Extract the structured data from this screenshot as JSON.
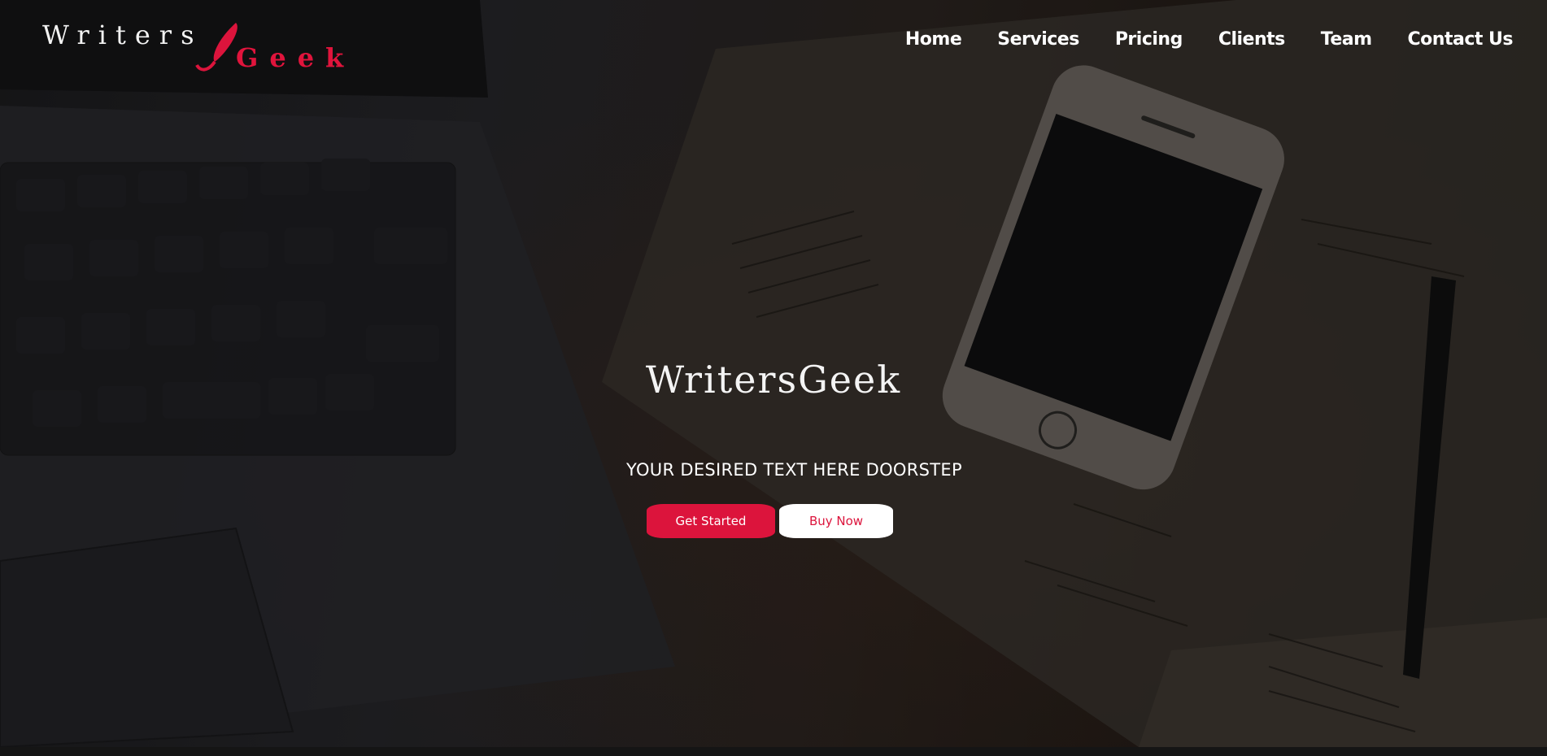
{
  "brand": {
    "logo_word_1": "Writers",
    "logo_word_2": "Geek",
    "accent": "#dc143c"
  },
  "nav": {
    "items": [
      {
        "label": "Home"
      },
      {
        "label": "Services"
      },
      {
        "label": "Pricing"
      },
      {
        "label": "Clients"
      },
      {
        "label": "Team"
      },
      {
        "label": "Contact Us"
      }
    ]
  },
  "hero": {
    "title": "WritersGeek",
    "tagline": "YOUR DESIRED TEXT HERE DOORSTEP",
    "primary_button": "Get Started",
    "secondary_button": "Buy Now"
  },
  "icons": {
    "logo_mark": "quill-icon"
  }
}
